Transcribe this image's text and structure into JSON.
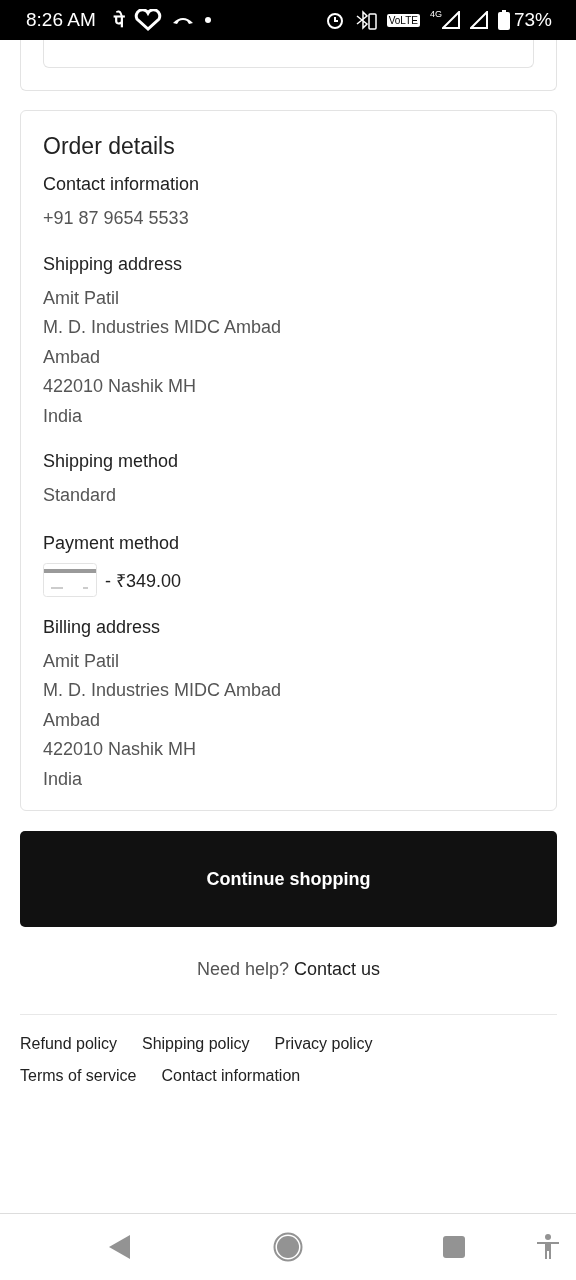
{
  "status_bar": {
    "time": "8:26 AM",
    "app_glyph": "पे",
    "volte": "VoLTE",
    "network": "4G",
    "battery": "73%"
  },
  "order_details": {
    "title": "Order details",
    "sections": [
      {
        "kind": "text",
        "heading": "Contact information",
        "lines": [
          "+91 87 9654 5533"
        ]
      },
      {
        "kind": "text",
        "heading": "Shipping address",
        "lines": [
          "Amit Patil",
          "M. D. Industries MIDC Ambad",
          "Ambad",
          "422010 Nashik MH",
          "India"
        ]
      },
      {
        "kind": "text",
        "heading": "Shipping method",
        "lines": [
          "Standard"
        ]
      },
      {
        "kind": "payment",
        "heading": "Payment method",
        "amount": "- ₹349.00"
      },
      {
        "kind": "text",
        "heading": "Billing address",
        "lines": [
          "Amit Patil",
          "M. D. Industries MIDC Ambad",
          "Ambad",
          "422010 Nashik MH",
          "India"
        ]
      }
    ]
  },
  "continue_button": "Continue shopping",
  "help": {
    "text": "Need help?",
    "link": "Contact us"
  },
  "footer_links": [
    [
      "Refund policy",
      "Shipping policy",
      "Privacy policy"
    ],
    [
      "Terms of service",
      "Contact information"
    ]
  ]
}
